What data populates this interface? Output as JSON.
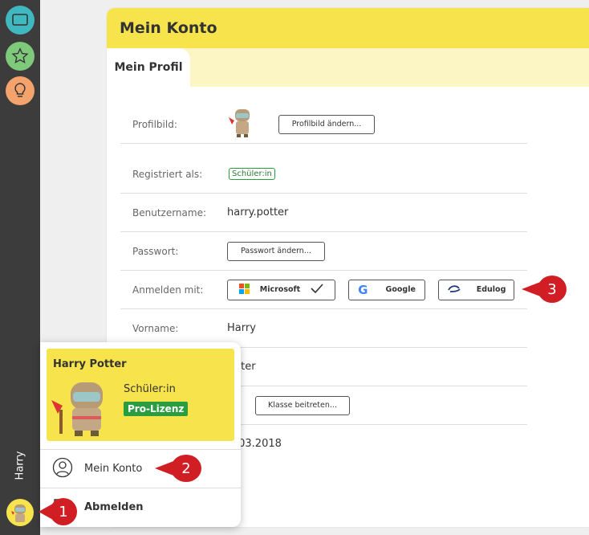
{
  "sidebar": {
    "icons": [
      "monitor-icon",
      "star-icon",
      "lightbulb-icon"
    ],
    "colors": [
      "#3fb8c0",
      "#7fc97a",
      "#f5a36c"
    ],
    "user_label": "Harry"
  },
  "account": {
    "title": "Mein Konto",
    "tab": "Mein Profil",
    "rows": {
      "profile_picture": {
        "label": "Profilbild:",
        "button": "Profilbild ändern..."
      },
      "registered_as": {
        "label": "Registriert als:",
        "badge": "Schüler:in"
      },
      "username": {
        "label": "Benutzername:",
        "value": "harry.potter"
      },
      "password": {
        "label": "Passwort:",
        "button": "Passwort ändern..."
      },
      "login_with": {
        "label": "Anmelden mit:",
        "microsoft": "Microsoft",
        "google": "Google",
        "edulog": "Edulog"
      },
      "first_name": {
        "label": "Vorname:",
        "value": "Harry"
      },
      "last_name": {
        "value": "tter"
      },
      "class": {
        "button": "Klasse beitreten..."
      },
      "date": {
        "value": ".03.2018"
      }
    }
  },
  "popup": {
    "name": "Harry Potter",
    "role": "Schüler:in",
    "license": "Pro-Lizenz",
    "menu": {
      "account": "Mein Konto",
      "logout": "Abmelden"
    }
  },
  "callouts": [
    "1",
    "2",
    "3"
  ]
}
